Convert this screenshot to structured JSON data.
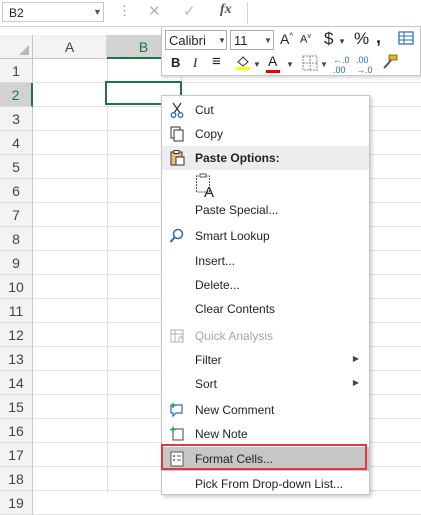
{
  "formula_bar": {
    "name_box": "B2",
    "fx_label": "fx",
    "separator": "⋮",
    "cancel": "✕",
    "enter": "✓"
  },
  "grid": {
    "columns": [
      "A",
      "B"
    ],
    "rows": [
      "1",
      "2",
      "3",
      "4",
      "5",
      "6",
      "7",
      "8",
      "9",
      "10",
      "11",
      "12",
      "13",
      "14",
      "15",
      "16",
      "17",
      "18",
      "19"
    ],
    "selected_cell": "B2",
    "accent_color": "#217346"
  },
  "mini_toolbar": {
    "font_name": "Calibri",
    "font_size": "11",
    "grow_font": "A",
    "shrink_font": "A",
    "currency": "$",
    "percent": "%",
    "comma": ",",
    "bold": "B",
    "italic": "I",
    "align": "≡",
    "font_color_letter": "A",
    "fill_color": "#ffff00",
    "font_color": "#e00000"
  },
  "context_menu": {
    "cut": "Cut",
    "copy": "Copy",
    "paste_options": "Paste Options:",
    "paste_special": "Paste Special...",
    "smart_lookup": "Smart Lookup",
    "insert": "Insert...",
    "delete": "Delete...",
    "clear_contents": "Clear Contents",
    "quick_analysis": "Quick Analysis",
    "filter": "Filter",
    "sort": "Sort",
    "new_comment": "New Comment",
    "new_note": "New Note",
    "format_cells": "Format Cells...",
    "pick_from_dropdown": "Pick From Drop-down List...",
    "highlight_color": "#e0393e"
  }
}
